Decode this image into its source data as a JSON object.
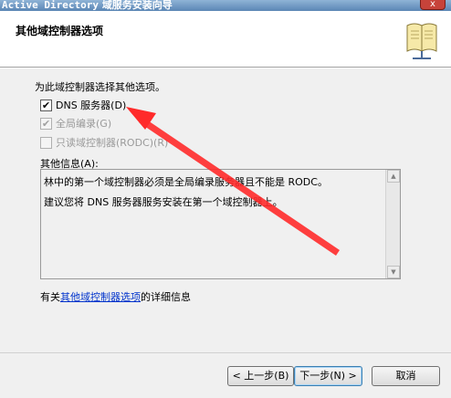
{
  "window": {
    "title_prefix": "Active Directory",
    "title_suffix": "域服务安装向导",
    "close_glyph": "x"
  },
  "header": {
    "title": "其他域控制器选项",
    "icon": "book-icon"
  },
  "main": {
    "prompt": "为此域控制器选择其他选项。",
    "options": [
      {
        "label": "DNS 服务器(D)",
        "checked": true,
        "enabled": true
      },
      {
        "label": "全局编录(G)",
        "checked": true,
        "enabled": false
      },
      {
        "label": "只读域控制器(RODC)(R)",
        "checked": false,
        "enabled": false
      }
    ],
    "info_label": "其他信息(A):",
    "info_lines": [
      "林中的第一个域控制器必须是全局编录服务器且不能是 RODC。",
      "建议您将 DNS 服务器服务安装在第一个域控制器上。"
    ],
    "more_info_prefix": "有关",
    "more_info_link": "其他域控制器选项",
    "more_info_suffix": "的详细信息"
  },
  "footer": {
    "back_label": "< 上一步(B)",
    "next_label": "下一步(N) >",
    "cancel_label": "取消"
  },
  "colors": {
    "annotation": "#ff2a2a",
    "link": "#0033cc"
  }
}
